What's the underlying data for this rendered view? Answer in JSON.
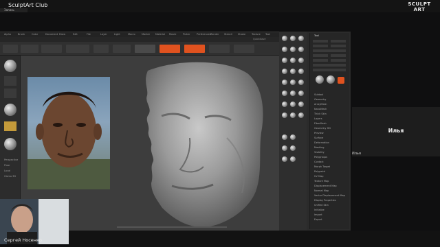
{
  "app": {
    "club_title": "SculptArt Club",
    "rec_label": "Запись",
    "brand": {
      "word": "SCULPT ART",
      "tag": ""
    }
  },
  "zbrush": {
    "menubar_items": [
      "Alpha",
      "Brush",
      "Color",
      "Document",
      "Draw",
      "Edit",
      "File",
      "Layer",
      "Light",
      "Macro",
      "Marker",
      "Material",
      "Movie",
      "Picker",
      "Preferences",
      "Render",
      "Stencil",
      "Stroke",
      "Texture",
      "Tool",
      "Transform",
      "Zplugin",
      "Zscript",
      "Help"
    ],
    "quicksave": "QuickSave",
    "default_script": "DefaultZScript",
    "tool_panel_title": "Tool",
    "tool_items": [
      "Subtool",
      "Geometry",
      "ArrayMesh",
      "NanoMesh",
      "Thick Skin",
      "Layers",
      "FiberMesh",
      "Geometry HD",
      "Preview",
      "Surface",
      "Deformation",
      "Masking",
      "Visibility",
      "Polygroups",
      "Contact",
      "Morph Target",
      "Polypaint",
      "UV Map",
      "Texture Map",
      "Displacement Map",
      "Normal Map",
      "Vector Displacement Map",
      "Display Properties",
      "Unified Skin",
      "Initialize",
      "Import",
      "Export"
    ],
    "left_labels": [
      "Perspective",
      "Floor",
      "Local",
      "Gizmo 3D"
    ]
  },
  "side_panel": {
    "name": "Илья",
    "small_name": "Илья"
  },
  "presenter": {
    "name": "Сергей Носенко"
  },
  "colors": {
    "accent": "#e0521f",
    "panel_bg": "#2b2b2b",
    "canvas_bg": "#3d3d3d"
  }
}
